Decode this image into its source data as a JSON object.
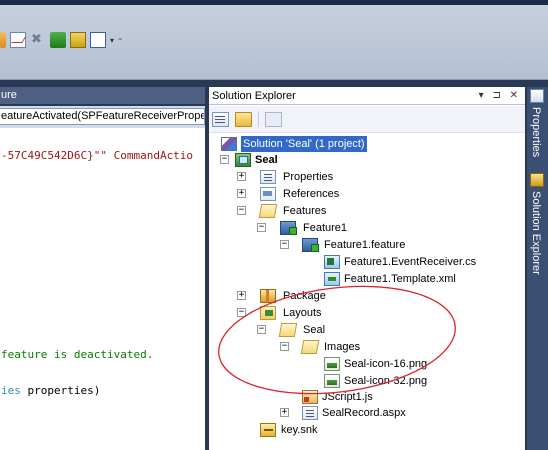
{
  "toolbar": {
    "dropdown_caret": "▾"
  },
  "editor": {
    "tab_title": "ure",
    "nav_text": "eatureActivated(SPFeatureReceiverPrope",
    "code": {
      "line1_string": "-57C49C542D6C}\"\" CommandActio",
      "line2_comment": " feature is deactivated.",
      "line3_type": "ies",
      "line3_rest": " properties)"
    }
  },
  "solution_explorer": {
    "title": "Solution Explorer",
    "title_controls": "▾ ⊐ ✕",
    "tree": [
      {
        "label": "Solution 'Seal' (1 project)",
        "icon": "solution-icon",
        "selected": true
      },
      {
        "label": "Seal",
        "icon": "project-icon",
        "expander": "−",
        "bold": true
      },
      {
        "label": "Properties",
        "icon": "properties-icon",
        "expander": "+"
      },
      {
        "label": "References",
        "icon": "references-icon",
        "expander": "+"
      },
      {
        "label": "Features",
        "icon": "folder-open-icon",
        "expander": "−"
      },
      {
        "label": "Feature1",
        "icon": "feature-icon",
        "expander": "−"
      },
      {
        "label": "Feature1.feature",
        "icon": "feature-file-icon",
        "expander": "−"
      },
      {
        "label": "Feature1.EventReceiver.cs",
        "icon": "cs-file-icon"
      },
      {
        "label": "Feature1.Template.xml",
        "icon": "xml-file-icon"
      },
      {
        "label": "Package",
        "icon": "package-icon",
        "expander": "+"
      },
      {
        "label": "Layouts",
        "icon": "layouts-folder-icon",
        "expander": "−"
      },
      {
        "label": "Seal",
        "icon": "folder-open-icon",
        "expander": "−"
      },
      {
        "label": "Images",
        "icon": "folder-open-icon",
        "expander": "−"
      },
      {
        "label": "Seal-icon-16.png",
        "icon": "png-file-icon"
      },
      {
        "label": "Seal-icon-32.png",
        "icon": "png-file-icon"
      },
      {
        "label": "JScript1.js",
        "icon": "js-file-icon"
      },
      {
        "label": "SealRecord.aspx",
        "icon": "aspx-file-icon",
        "expander": "+"
      },
      {
        "label": "key.snk",
        "icon": "key-file-icon"
      }
    ]
  },
  "side_tabs": {
    "properties": "Properties",
    "solution_explorer": "Solution Explorer"
  },
  "colors": {
    "ide_background": "#293955",
    "selection": "#3169c6",
    "annotation": "#d9262b",
    "string": "#a31515",
    "comment": "#008000",
    "type": "#2b91af"
  }
}
